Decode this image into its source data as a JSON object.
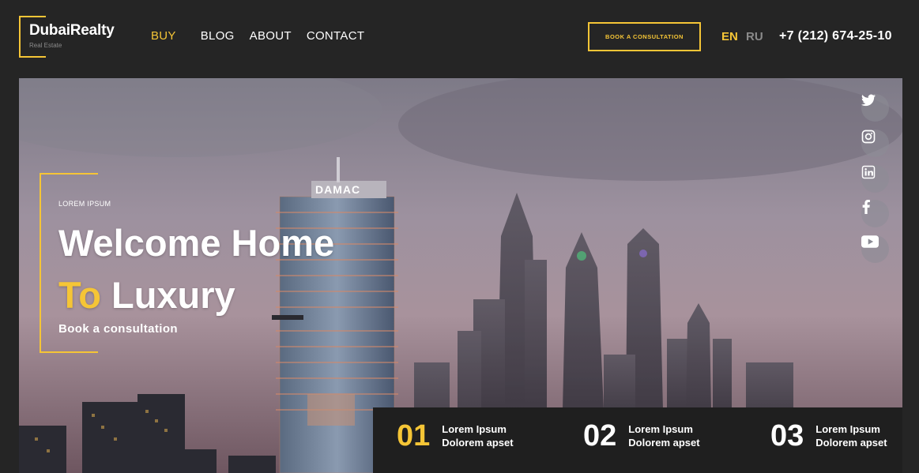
{
  "brand": {
    "name": "DubaiRealty",
    "tagline": "Real Estate",
    "accent_color": "#f5c536"
  },
  "nav": {
    "items": [
      {
        "label": "BUY",
        "active": true
      },
      {
        "label": "BLOG"
      },
      {
        "label": "ABOUT"
      },
      {
        "label": "CONTACT"
      }
    ]
  },
  "header": {
    "book_label": "BOOK A CONSULTATION",
    "lang_en": "EN",
    "lang_ru": "RU",
    "phone": "+7 (212) 674-25-10"
  },
  "hero": {
    "eyebrow": "LOREM IPSUM",
    "title_line1": "Welcome Home",
    "title_accent": "To",
    "title_rest": " Luxury",
    "cta": "Book a consultation",
    "tower_sign": "DAMAC"
  },
  "social": [
    {
      "icon": "twitter-icon"
    },
    {
      "icon": "instagram-icon"
    },
    {
      "icon": "linkedin-icon"
    },
    {
      "icon": "facebook-icon"
    },
    {
      "icon": "youtube-icon"
    }
  ],
  "stats": [
    {
      "num": "01",
      "line1": "Lorem Ipsum",
      "line2": "Dolorem apset"
    },
    {
      "num": "02",
      "line1": "Lorem Ipsum",
      "line2": "Dolorem apset"
    },
    {
      "num": "03",
      "line1": "Lorem Ipsum",
      "line2": "Dolorem apset"
    }
  ]
}
